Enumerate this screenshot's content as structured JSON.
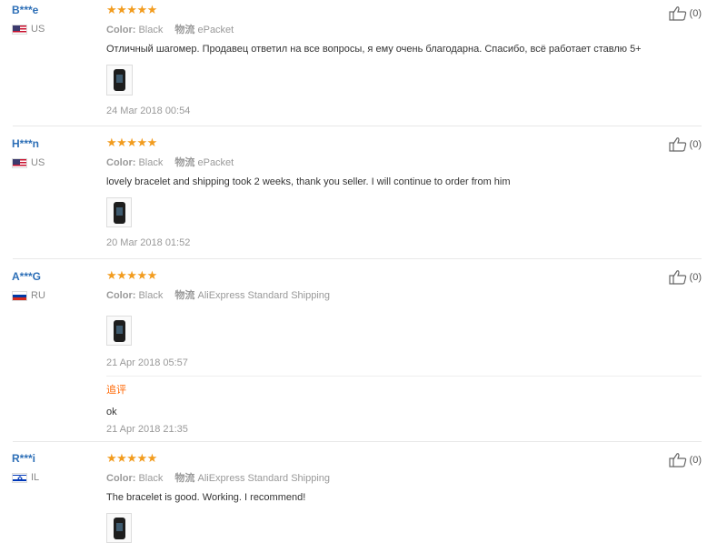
{
  "reviews": [
    {
      "user": "B***e",
      "country": "US",
      "stars": "★★★★★",
      "color_label": "Color:",
      "color_value": "Black",
      "shipping_label": "物流",
      "shipping_value": "ePacket",
      "text": "Отличный шагомер. Продавец ответил на все вопросы, я ему очень благодарна. Спасибо, всё работает ставлю 5+",
      "date": "24 Mar 2018 00:54",
      "likes": "(0)"
    },
    {
      "user": "H***n",
      "country": "US",
      "stars": "★★★★★",
      "color_label": "Color:",
      "color_value": "Black",
      "shipping_label": "物流",
      "shipping_value": "ePacket",
      "text": "lovely bracelet and shipping took 2 weeks, thank you seller. I will continue to order from him",
      "date": "20 Mar 2018 01:52",
      "likes": "(0)"
    },
    {
      "user": "A***G",
      "country": "RU",
      "stars": "★★★★★",
      "color_label": "Color:",
      "color_value": "Black",
      "shipping_label": "物流",
      "shipping_value": "AliExpress Standard Shipping",
      "date": "21 Apr 2018 05:57",
      "likes": "(0)",
      "additional": {
        "title": "追评",
        "text": "ok",
        "date": "21 Apr 2018 21:35"
      }
    },
    {
      "user": "R***i",
      "country": "IL",
      "stars": "★★★★★",
      "color_label": "Color:",
      "color_value": "Black",
      "shipping_label": "物流",
      "shipping_value": "AliExpress Standard Shipping",
      "text": "The bracelet is good. Working. I recommend!",
      "likes": "(0)"
    }
  ],
  "colors": {
    "username": "#2d6fb7",
    "stars": "#f29c1f",
    "additional_title": "#ff6600"
  },
  "icons": {
    "like": "thumbs-up-icon",
    "rating": "star-icon"
  }
}
